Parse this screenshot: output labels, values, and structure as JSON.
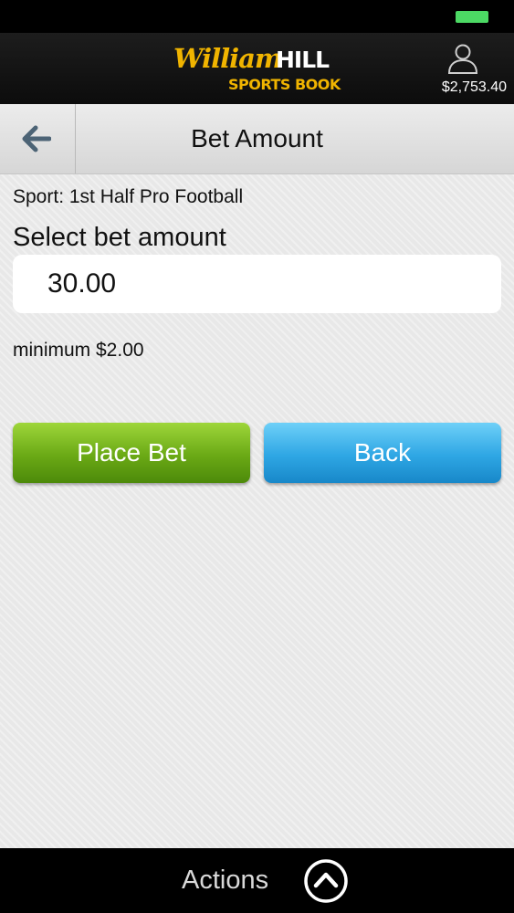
{
  "header": {
    "logo_script": "William",
    "logo_hill": "HILL",
    "logo_sub": "SPORTS BOOK",
    "balance": "$2,753.40"
  },
  "title_bar": {
    "title": "Bet Amount"
  },
  "form": {
    "sport_line": "Sport: 1st Half Pro Football",
    "select_label": "Select bet amount",
    "amount_value": "30.00",
    "minimum_text": "minimum $2.00"
  },
  "buttons": {
    "place_bet": "Place Bet",
    "back": "Back"
  },
  "footer": {
    "actions_label": "Actions"
  },
  "icons": {
    "back": "left-arrow-icon",
    "account": "user-icon",
    "actions": "chevron-up-circle-icon",
    "battery": "battery-icon"
  },
  "colors": {
    "brand_gold": "#f0b400",
    "place_bet_green": "#6aa915",
    "back_blue": "#2ea6e4",
    "battery_green": "#4cd964"
  }
}
